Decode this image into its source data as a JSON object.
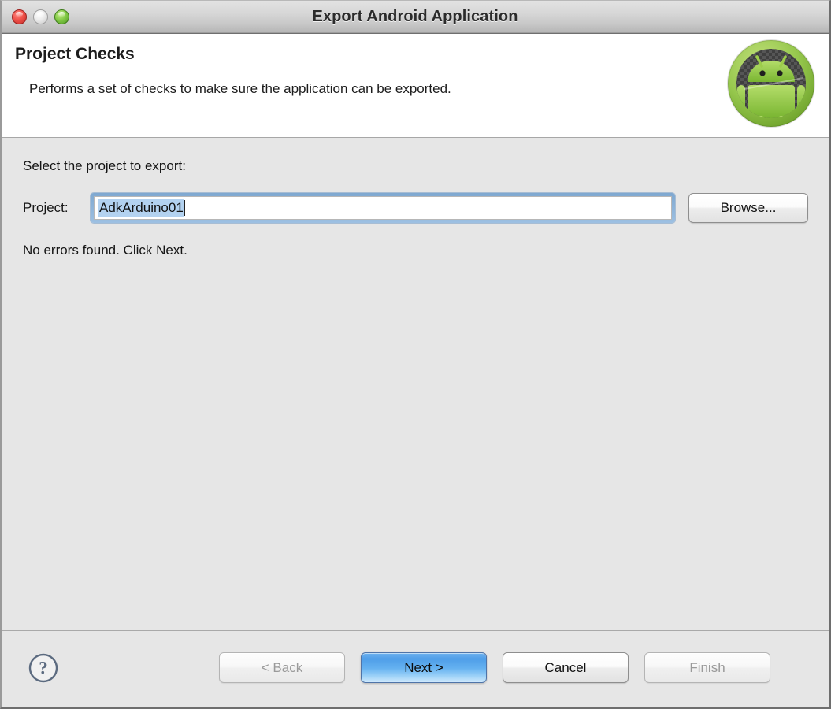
{
  "window": {
    "title": "Export Android Application",
    "traffic_lights": [
      {
        "name": "close-button",
        "color": "#f0534b"
      },
      {
        "name": "minimize-button",
        "color": "#ececec"
      },
      {
        "name": "zoom-button",
        "color": "#86cc49"
      }
    ]
  },
  "header": {
    "title": "Project Checks",
    "description": "Performs a set of checks to make sure the application can be exported.",
    "logo_icon": "android-robot-icon"
  },
  "content": {
    "instruction": "Select the project to export:",
    "project_label": "Project:",
    "project_value": "AdkArduino01",
    "project_placeholder": "",
    "browse_label": "Browse...",
    "status_message": "No errors found. Click Next."
  },
  "footer": {
    "help_icon": "question-mark-icon",
    "buttons": [
      {
        "label": "< Back",
        "state": "disabled",
        "name": "back-button"
      },
      {
        "label": "Next >",
        "state": "default",
        "name": "next-button"
      },
      {
        "label": "Cancel",
        "state": "enabled",
        "name": "cancel-button"
      },
      {
        "label": "Finish",
        "state": "disabled",
        "name": "finish-button"
      }
    ]
  },
  "colors": {
    "accent_blue": "#4f9ee8",
    "selection_blue": "#b3d2f0",
    "window_bg": "#e6e6e6",
    "header_bg": "#ffffff",
    "android_green": "#8fc447"
  }
}
